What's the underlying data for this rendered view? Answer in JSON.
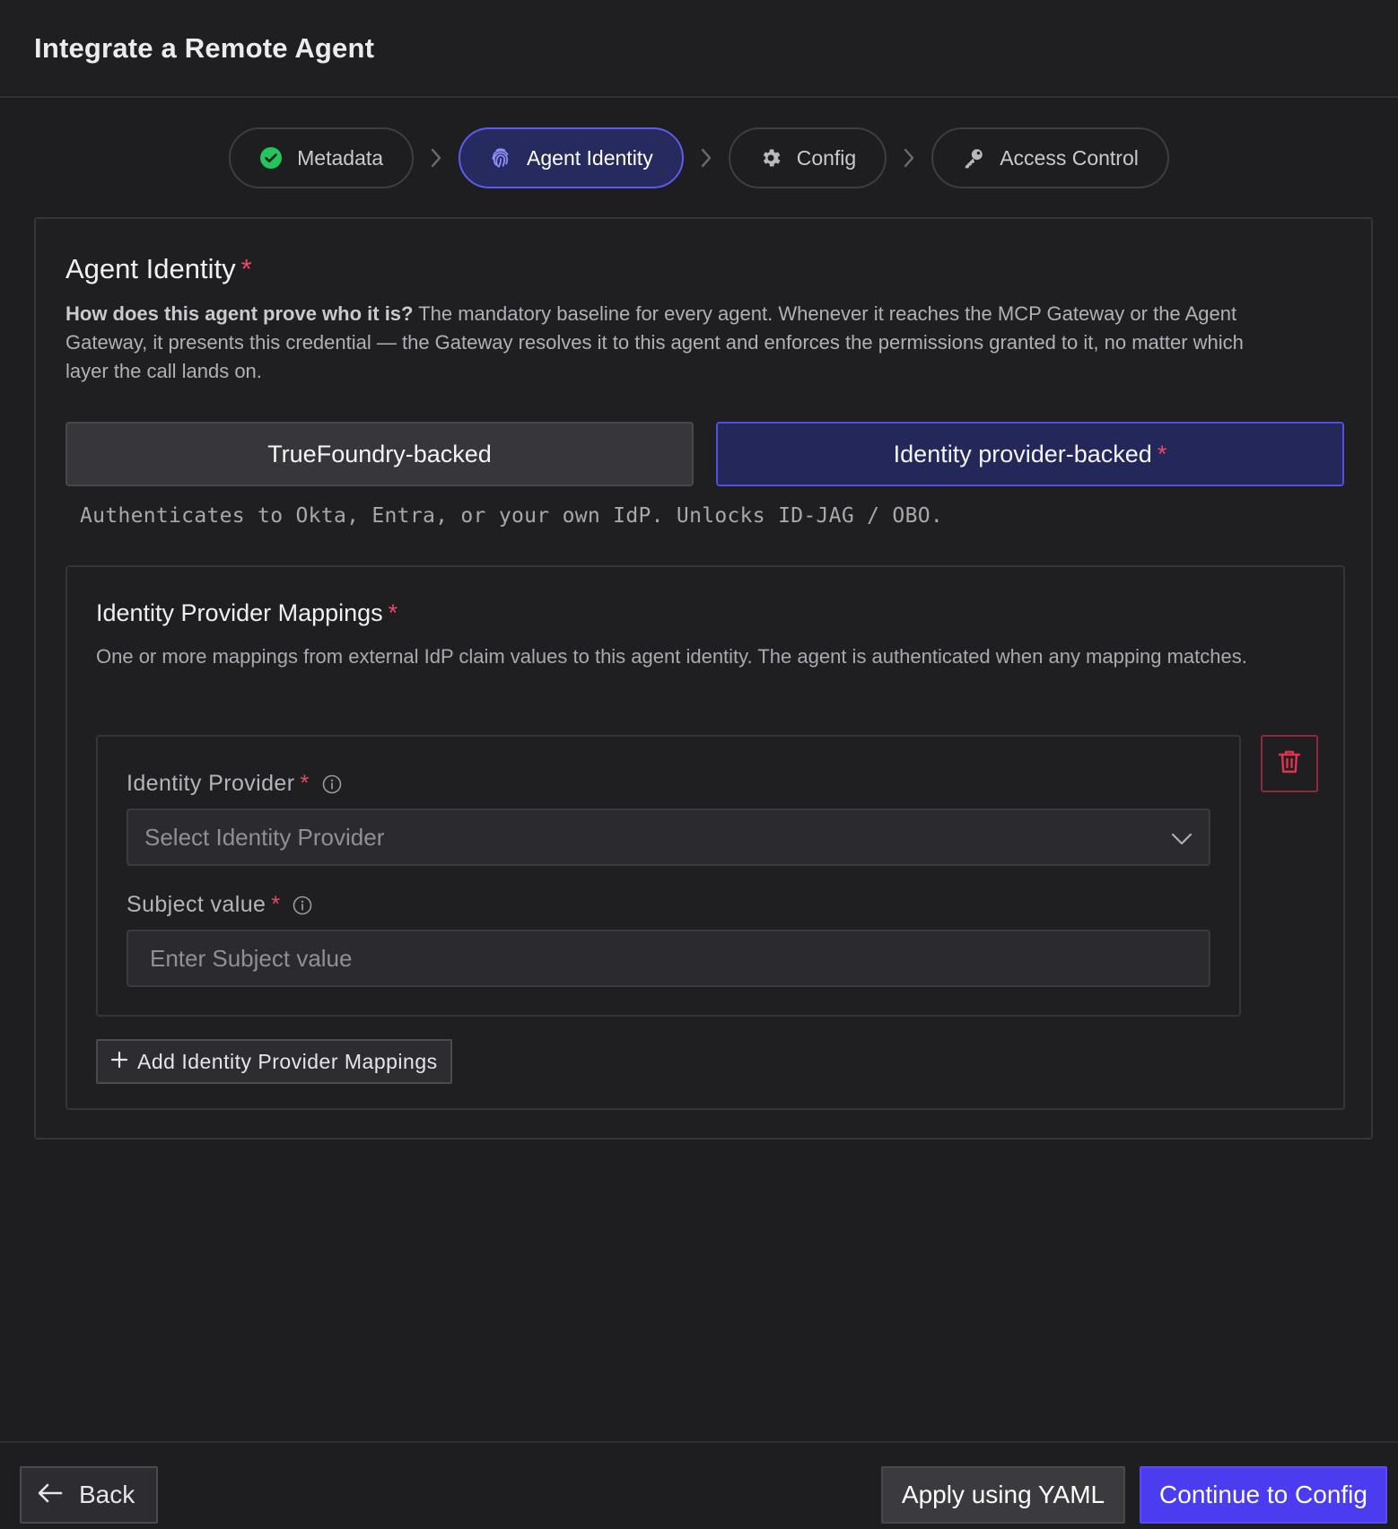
{
  "header": {
    "title": "Integrate a Remote Agent"
  },
  "stepper": {
    "steps": [
      {
        "label": "Metadata",
        "icon": "check-circle-icon",
        "state": "completed"
      },
      {
        "label": "Agent Identity",
        "icon": "fingerprint-icon",
        "state": "active"
      },
      {
        "label": "Config",
        "icon": "gear-icon",
        "state": "pending"
      },
      {
        "label": "Access Control",
        "icon": "key-icon",
        "state": "pending"
      }
    ]
  },
  "identity": {
    "title": "Agent Identity",
    "required_mark": "*",
    "description_bold": "How does this agent prove who it is?",
    "description_rest": " The mandatory baseline for every agent. Whenever it reaches the MCP Gateway or the Agent Gateway, it presents this credential — the Gateway resolves it to this agent and enforces the permissions granted to it, no matter which layer the call lands on.",
    "options": {
      "truefoundry": "TrueFoundry-backed",
      "idp": "Identity provider-backed",
      "selected": "idp"
    },
    "option_hint": "Authenticates to Okta, Entra, or your own IdP. Unlocks ID-JAG / OBO."
  },
  "mappings": {
    "title": "Identity Provider Mappings",
    "description": "One or more mappings from external IdP claim values to this agent identity. The agent is authenticated when any mapping matches.",
    "provider_label": "Identity Provider",
    "provider_placeholder": "Select Identity Provider",
    "subject_label": "Subject value",
    "subject_placeholder": "Enter Subject value",
    "add_label": "Add Identity Provider Mappings"
  },
  "footer": {
    "back_label": "Back",
    "yaml_label": "Apply using YAML",
    "continue_label": "Continue to Config"
  },
  "colors": {
    "accent": "#4b3cf0",
    "active_step_bg": "#272a5e",
    "success": "#22c55e",
    "danger": "#e0334f"
  }
}
